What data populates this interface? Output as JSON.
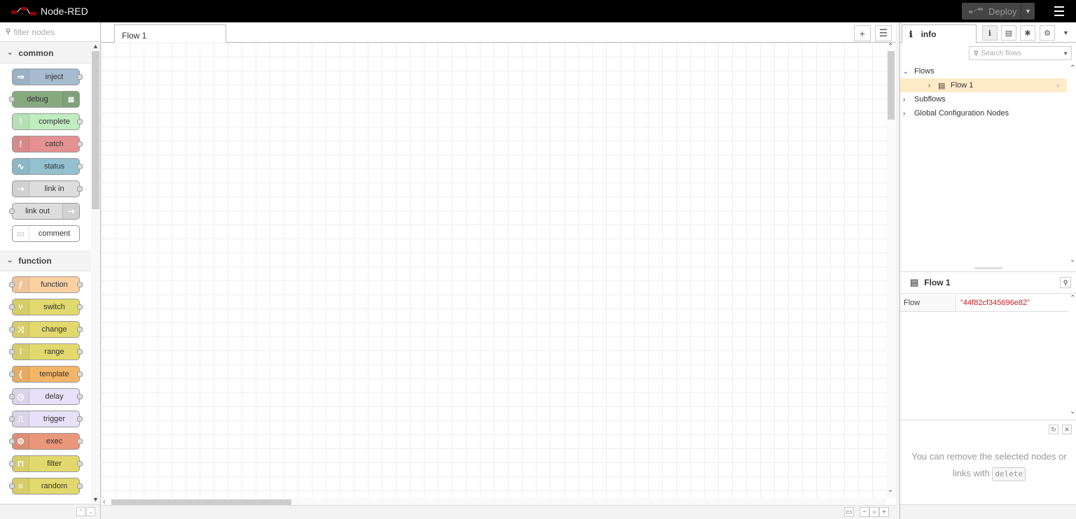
{
  "header": {
    "app_name": "Node-RED",
    "deploy_label": "Deploy"
  },
  "palette": {
    "filter_placeholder": "filter nodes",
    "categories": [
      {
        "name": "common",
        "nodes": [
          {
            "label": "inject",
            "color": "#a6bbcf",
            "icon": "inject-arrow-icon",
            "glyph": "⇒"
          },
          {
            "label": "debug",
            "color": "#87a980",
            "icon": "debug-list-icon",
            "glyph": "≣"
          },
          {
            "label": "complete",
            "color": "#c0edc0",
            "icon": "alert-icon",
            "glyph": "!"
          },
          {
            "label": "catch",
            "color": "#e49191",
            "icon": "alert-icon",
            "glyph": "!"
          },
          {
            "label": "status",
            "color": "#94c1d0",
            "icon": "pulse-icon",
            "glyph": "∿"
          },
          {
            "label": "link in",
            "color": "#dddddd",
            "icon": "link-icon",
            "glyph": "⇢"
          },
          {
            "label": "link out",
            "color": "#dddddd",
            "icon": "link-icon",
            "glyph": "⇢"
          },
          {
            "label": "comment",
            "color": "#ffffff",
            "icon": "comment-icon",
            "glyph": "▭"
          }
        ]
      },
      {
        "name": "function",
        "nodes": [
          {
            "label": "function",
            "color": "#fdd0a2",
            "icon": "function-icon",
            "glyph": "ƒ"
          },
          {
            "label": "switch",
            "color": "#e2d96e",
            "icon": "switch-icon",
            "glyph": "⑂"
          },
          {
            "label": "change",
            "color": "#e2d96e",
            "icon": "shuffle-icon",
            "glyph": "⤨"
          },
          {
            "label": "range",
            "color": "#e2d96e",
            "icon": "range-icon",
            "glyph": "⁞"
          },
          {
            "label": "template",
            "color": "#f3b567",
            "icon": "template-icon",
            "glyph": "{"
          },
          {
            "label": "delay",
            "color": "#e6e0f8",
            "icon": "timer-icon",
            "glyph": "◷"
          },
          {
            "label": "trigger",
            "color": "#e6e0f8",
            "icon": "trigger-icon",
            "glyph": "⎍"
          },
          {
            "label": "exec",
            "color": "#e9967a",
            "icon": "gear-icon",
            "glyph": "⚙"
          },
          {
            "label": "filter",
            "color": "#e2d96e",
            "icon": "filter-icon",
            "glyph": "⊓"
          },
          {
            "label": "random",
            "color": "#e2d96e",
            "icon": "random-icon",
            "glyph": "≡"
          }
        ]
      }
    ]
  },
  "workspace": {
    "tab_label": "Flow 1"
  },
  "sidebar": {
    "tab_label": "info",
    "search_placeholder": "Search flows",
    "tree": {
      "flows": "Flows",
      "flow1": "Flow 1",
      "subflows": "Subflows",
      "global": "Global Configuration Nodes"
    },
    "info_title": "Flow 1",
    "prop_key": "Flow",
    "prop_value": "\"44f82cf345696e82\"",
    "tip_text_1": "You can remove the selected nodes or links with",
    "tip_kbd": "delete"
  }
}
